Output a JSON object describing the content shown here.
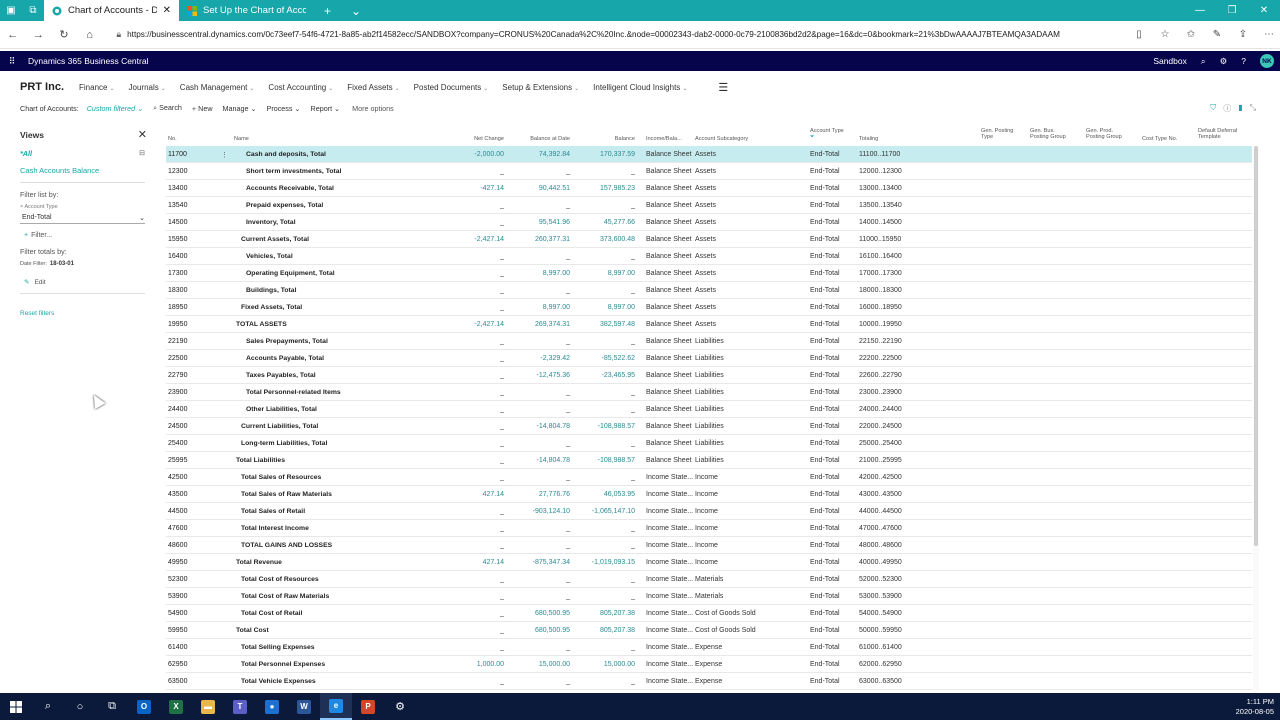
{
  "browser": {
    "tabs": [
      {
        "title": "Chart of Accounts - Dyr",
        "active": true
      },
      {
        "title": "Set Up the Chart of Accoun",
        "active": false
      }
    ],
    "url": "https://businesscentral.dynamics.com/0c73eef7-54f6-4721-8a85-ab2f14582ecc/SANDBOX?company=CRONUS%20Canada%2C%20Inc.&node=00002343-dab2-0000-0c79-2100836bd2d2&page=16&dc=0&bookmark=21%3bDwAAAAJ7BTEAMQA3ADAAM"
  },
  "app": {
    "name": "Dynamics 365 Business Central",
    "environment": "Sandbox",
    "user_initials": "NK",
    "company": "PRT Inc."
  },
  "menu": [
    "Finance",
    "Journals",
    "Cash Management",
    "Cost Accounting",
    "Fixed Assets",
    "Posted Documents",
    "Setup & Extensions",
    "Intelligent Cloud Insights"
  ],
  "actions": {
    "page_title": "Chart of Accounts:",
    "filter_label": "Custom filtered",
    "search": "Search",
    "new": "New",
    "manage": "Manage",
    "process": "Process",
    "report": "Report",
    "more": "More options"
  },
  "filter_pane": {
    "views_title": "Views",
    "all": "*All",
    "cash_balance": "Cash Accounts Balance",
    "filter_list_by": "Filter list by:",
    "account_type_label": "Account Type",
    "account_type_value": "End-Total",
    "add_filter": "Filter...",
    "filter_totals_by": "Filter totals by:",
    "date_filter_label": "Date Filter:",
    "date_filter_value": "18-03-01",
    "edit": "Edit",
    "reset": "Reset filters"
  },
  "grid": {
    "headers": {
      "no": "No.",
      "name": "Name",
      "net_change": "Net Change",
      "balance_at_date": "Balance at Date",
      "balance": "Balance",
      "income_balance": "Income/Bala...",
      "account_subcategory": "Account Subcategory",
      "account_type": "Account Type",
      "totaling": "Totaling",
      "gen_posting_type": "Gen. Posting Type",
      "gen_bus_posting_group": "Gen. Bus. Posting Group",
      "gen_prod_posting_group": "Gen. Prod. Posting Group",
      "cost_type_no": "Cost Type No.",
      "default_deferral_template": "Default Deferral Template"
    },
    "rows": [
      {
        "no": "11700",
        "name": "Cash and deposits, Total",
        "indent": 2,
        "nc": "-2,000.00",
        "bd": "74,392.84",
        "bal": "170,337.59",
        "ib": "Balance Sheet",
        "sub": "Assets",
        "type": "End-Total",
        "tot": "11100..11700"
      },
      {
        "no": "12300",
        "name": "Short term investments, Total",
        "indent": 2,
        "nc": "_",
        "bd": "_",
        "bal": "_",
        "ib": "Balance Sheet",
        "sub": "Assets",
        "type": "End-Total",
        "tot": "12000..12300"
      },
      {
        "no": "13400",
        "name": "Accounts Receivable, Total",
        "indent": 2,
        "nc": "-427.14",
        "bd": "90,442.51",
        "bal": "157,985.23",
        "ib": "Balance Sheet",
        "sub": "Assets",
        "type": "End-Total",
        "tot": "13000..13400"
      },
      {
        "no": "13540",
        "name": "Prepaid expenses, Total",
        "indent": 2,
        "nc": "_",
        "bd": "_",
        "bal": "_",
        "ib": "Balance Sheet",
        "sub": "Assets",
        "type": "End-Total",
        "tot": "13500..13540"
      },
      {
        "no": "14500",
        "name": "Inventory, Total",
        "indent": 2,
        "nc": "_",
        "bd": "95,541.96",
        "bal": "45,277.66",
        "ib": "Balance Sheet",
        "sub": "Assets",
        "type": "End-Total",
        "tot": "14000..14500"
      },
      {
        "no": "15950",
        "name": "Current Assets, Total",
        "indent": 1,
        "nc": "-2,427.14",
        "bd": "260,377.31",
        "bal": "373,600.48",
        "ib": "Balance Sheet",
        "sub": "Assets",
        "type": "End-Total",
        "tot": "11000..15950"
      },
      {
        "no": "16400",
        "name": "Vehicles, Total",
        "indent": 2,
        "nc": "_",
        "bd": "_",
        "bal": "_",
        "ib": "Balance Sheet",
        "sub": "Assets",
        "type": "End-Total",
        "tot": "16100..16400"
      },
      {
        "no": "17300",
        "name": "Operating Equipment, Total",
        "indent": 2,
        "nc": "_",
        "bd": "8,997.00",
        "bal": "8,997.00",
        "ib": "Balance Sheet",
        "sub": "Assets",
        "type": "End-Total",
        "tot": "17000..17300"
      },
      {
        "no": "18300",
        "name": "Buildings, Total",
        "indent": 2,
        "nc": "_",
        "bd": "_",
        "bal": "_",
        "ib": "Balance Sheet",
        "sub": "Assets",
        "type": "End-Total",
        "tot": "18000..18300"
      },
      {
        "no": "18950",
        "name": "Fixed Assets, Total",
        "indent": 1,
        "nc": "_",
        "bd": "8,997.00",
        "bal": "8,997.00",
        "ib": "Balance Sheet",
        "sub": "Assets",
        "type": "End-Total",
        "tot": "16000..18950"
      },
      {
        "no": "19950",
        "name": "TOTAL ASSETS",
        "indent": 0,
        "nc": "-2,427.14",
        "bd": "269,374.31",
        "bal": "382,597.48",
        "ib": "Balance Sheet",
        "sub": "Assets",
        "type": "End-Total",
        "tot": "10000..19950"
      },
      {
        "no": "22190",
        "name": "Sales Prepayments, Total",
        "indent": 2,
        "nc": "_",
        "bd": "_",
        "bal": "_",
        "ib": "Balance Sheet",
        "sub": "Liabilities",
        "type": "End-Total",
        "tot": "22150..22190"
      },
      {
        "no": "22500",
        "name": "Accounts Payable, Total",
        "indent": 2,
        "nc": "_",
        "bd": "-2,329.42",
        "bal": "-85,522.62",
        "ib": "Balance Sheet",
        "sub": "Liabilities",
        "type": "End-Total",
        "tot": "22200..22500"
      },
      {
        "no": "22790",
        "name": "Taxes Payables, Total",
        "indent": 2,
        "nc": "_",
        "bd": "-12,475.36",
        "bal": "-23,465.95",
        "ib": "Balance Sheet",
        "sub": "Liabilities",
        "type": "End-Total",
        "tot": "22600..22790"
      },
      {
        "no": "23900",
        "name": "Total Personnel-related Items",
        "indent": 2,
        "nc": "_",
        "bd": "_",
        "bal": "_",
        "ib": "Balance Sheet",
        "sub": "Liabilities",
        "type": "End-Total",
        "tot": "23000..23900"
      },
      {
        "no": "24400",
        "name": "Other Liabilities, Total",
        "indent": 2,
        "nc": "_",
        "bd": "_",
        "bal": "_",
        "ib": "Balance Sheet",
        "sub": "Liabilities",
        "type": "End-Total",
        "tot": "24000..24400"
      },
      {
        "no": "24500",
        "name": "Current Liabilities, Total",
        "indent": 1,
        "nc": "_",
        "bd": "-14,804.78",
        "bal": "-108,988.57",
        "ib": "Balance Sheet",
        "sub": "Liabilities",
        "type": "End-Total",
        "tot": "22000..24500"
      },
      {
        "no": "25400",
        "name": "Long-term Liabilities, Total",
        "indent": 1,
        "nc": "_",
        "bd": "_",
        "bal": "_",
        "ib": "Balance Sheet",
        "sub": "Liabilities",
        "type": "End-Total",
        "tot": "25000..25400"
      },
      {
        "no": "25995",
        "name": "Total Liabilities",
        "indent": 0,
        "nc": "_",
        "bd": "-14,804.78",
        "bal": "-108,988.57",
        "ib": "Balance Sheet",
        "sub": "Liabilities",
        "type": "End-Total",
        "tot": "21000..25995"
      },
      {
        "no": "42500",
        "name": "Total Sales of Resources",
        "indent": 1,
        "nc": "_",
        "bd": "_",
        "bal": "_",
        "ib": "Income State...",
        "sub": "Income",
        "type": "End-Total",
        "tot": "42000..42500"
      },
      {
        "no": "43500",
        "name": "Total Sales of Raw Materials",
        "indent": 1,
        "nc": "427.14",
        "bd": "27,776.76",
        "bal": "46,053.95",
        "ib": "Income State...",
        "sub": "Income",
        "type": "End-Total",
        "tot": "43000..43500"
      },
      {
        "no": "44500",
        "name": "Total Sales of Retail",
        "indent": 1,
        "nc": "_",
        "bd": "-903,124.10",
        "bal": "-1,065,147.10",
        "ib": "Income State...",
        "sub": "Income",
        "type": "End-Total",
        "tot": "44000..44500"
      },
      {
        "no": "47600",
        "name": "Total Interest Income",
        "indent": 1,
        "nc": "_",
        "bd": "_",
        "bal": "_",
        "ib": "Income State...",
        "sub": "Income",
        "type": "End-Total",
        "tot": "47000..47600"
      },
      {
        "no": "48600",
        "name": "TOTAL GAINS AND LOSSES",
        "indent": 1,
        "nc": "_",
        "bd": "_",
        "bal": "_",
        "ib": "Income State...",
        "sub": "Income",
        "type": "End-Total",
        "tot": "48000..48600"
      },
      {
        "no": "49950",
        "name": "Total Revenue",
        "indent": 0,
        "nc": "427.14",
        "bd": "-875,347.34",
        "bal": "-1,019,093.15",
        "ib": "Income State...",
        "sub": "Income",
        "type": "End-Total",
        "tot": "40000..49950"
      },
      {
        "no": "52300",
        "name": "Total Cost of Resources",
        "indent": 1,
        "nc": "_",
        "bd": "_",
        "bal": "_",
        "ib": "Income State...",
        "sub": "Materials",
        "type": "End-Total",
        "tot": "52000..52300"
      },
      {
        "no": "53900",
        "name": "Total Cost of Raw Materials",
        "indent": 1,
        "nc": "_",
        "bd": "_",
        "bal": "_",
        "ib": "Income State...",
        "sub": "Materials",
        "type": "End-Total",
        "tot": "53000..53900"
      },
      {
        "no": "54900",
        "name": "Total Cost of Retail",
        "indent": 1,
        "nc": "_",
        "bd": "680,500.95",
        "bal": "805,207.38",
        "ib": "Income State...",
        "sub": "Cost of Goods Sold",
        "type": "End-Total",
        "tot": "54000..54900"
      },
      {
        "no": "59950",
        "name": "Total Cost",
        "indent": 0,
        "nc": "_",
        "bd": "680,500.95",
        "bal": "805,207.38",
        "ib": "Income State...",
        "sub": "Cost of Goods Sold",
        "type": "End-Total",
        "tot": "50000..59950"
      },
      {
        "no": "61400",
        "name": "Total Selling Expenses",
        "indent": 1,
        "nc": "_",
        "bd": "_",
        "bal": "_",
        "ib": "Income State...",
        "sub": "Expense",
        "type": "End-Total",
        "tot": "61000..61400"
      },
      {
        "no": "62950",
        "name": "Total Personnel Expenses",
        "indent": 1,
        "nc": "1,000.00",
        "bd": "15,000.00",
        "bal": "15,000.00",
        "ib": "Income State...",
        "sub": "Expense",
        "type": "End-Total",
        "tot": "62000..62950"
      },
      {
        "no": "63500",
        "name": "Total Vehicle Expenses",
        "indent": 1,
        "nc": "_",
        "bd": "_",
        "bal": "_",
        "ib": "Income State...",
        "sub": "Expense",
        "type": "End-Total",
        "tot": "63000..63500"
      }
    ]
  },
  "taskbar": {
    "time": "1:11 PM",
    "date": "2020-08-05"
  }
}
